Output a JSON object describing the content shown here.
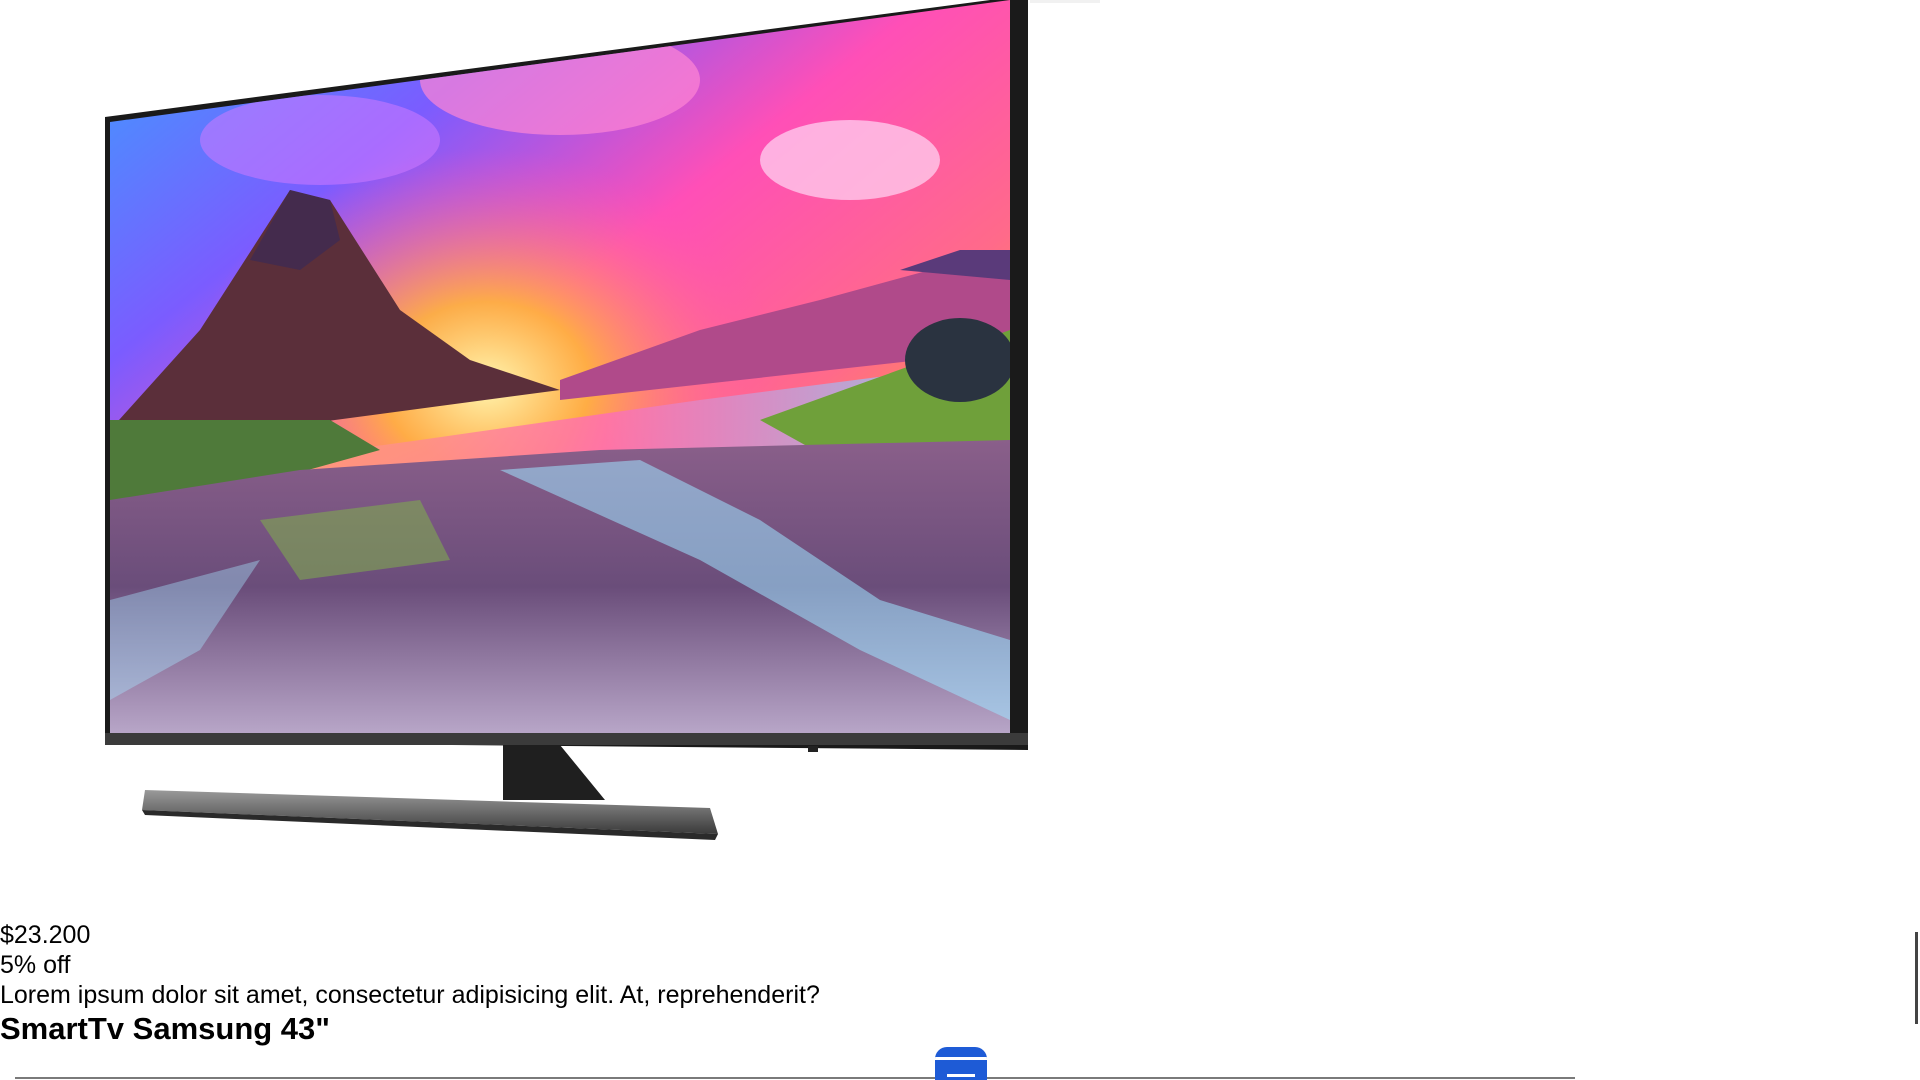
{
  "product": {
    "price": "$23.200",
    "discount": "5% off",
    "description": "Lorem ipsum dolor sit amet, consectetur adipisicing elit. At, reprehenderit?",
    "title": "SmartTv Samsung 43\"",
    "image_icon": "smart-tv-product-image"
  },
  "colors": {
    "accent": "#1e5bd6",
    "divider": "#7a7a7a"
  }
}
